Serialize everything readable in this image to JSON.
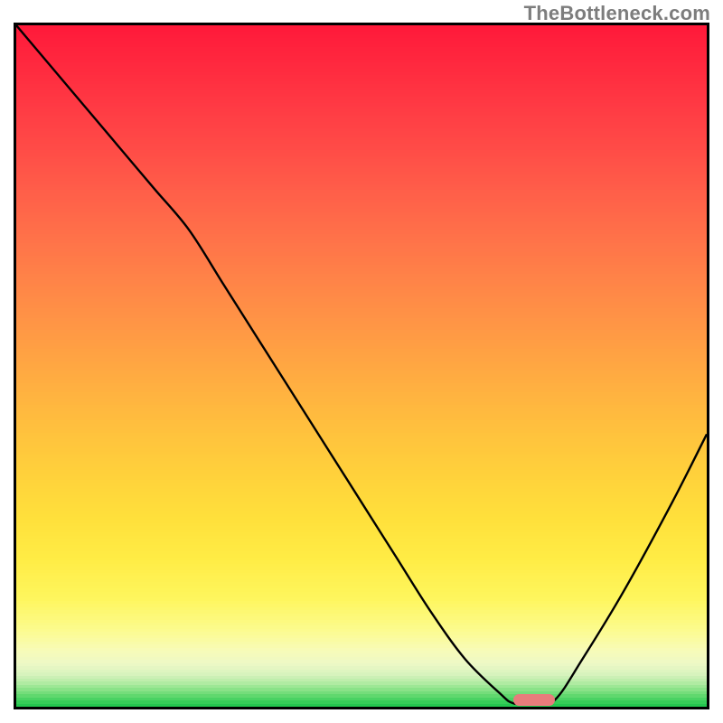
{
  "watermark": "TheBottleneck.com",
  "colors": {
    "frame": "#000000",
    "curve": "#000000",
    "marker": "#e87c7c"
  },
  "chart_data": {
    "type": "line",
    "title": "",
    "xlabel": "",
    "ylabel": "",
    "xlim": [
      0,
      100
    ],
    "ylim": [
      0,
      100
    ],
    "grid": false,
    "legend": false,
    "background_gradient_description": "vertical gradient red → orange → yellow → pale-yellow → green (bottleneck severity scale)",
    "curve": {
      "description": "Bottleneck severity curve; single V-shaped dip reaching 0 near x≈75",
      "x": [
        0,
        5,
        10,
        15,
        20,
        25,
        30,
        35,
        40,
        45,
        50,
        55,
        60,
        65,
        70,
        72,
        75,
        78,
        82,
        88,
        95,
        100
      ],
      "y": [
        100,
        94,
        88,
        82,
        76,
        70,
        62,
        54,
        46,
        38,
        30,
        22,
        14,
        7,
        2,
        0.5,
        0.5,
        1,
        7,
        17,
        30,
        40
      ]
    },
    "optimal_marker": {
      "x_start": 72,
      "x_end": 78,
      "y": 0.2
    },
    "gradient_stops": [
      {
        "pct": 0.0,
        "color": "#ff1a3a"
      },
      {
        "pct": 0.06,
        "color": "#ff2a3f"
      },
      {
        "pct": 0.12,
        "color": "#ff3b44"
      },
      {
        "pct": 0.18,
        "color": "#ff4c47"
      },
      {
        "pct": 0.24,
        "color": "#ff5e49"
      },
      {
        "pct": 0.3,
        "color": "#ff6f49"
      },
      {
        "pct": 0.36,
        "color": "#ff8048"
      },
      {
        "pct": 0.42,
        "color": "#ff9146"
      },
      {
        "pct": 0.48,
        "color": "#ffa243"
      },
      {
        "pct": 0.54,
        "color": "#ffb340"
      },
      {
        "pct": 0.6,
        "color": "#ffc33d"
      },
      {
        "pct": 0.66,
        "color": "#ffd23b"
      },
      {
        "pct": 0.72,
        "color": "#ffe03b"
      },
      {
        "pct": 0.78,
        "color": "#ffec45"
      },
      {
        "pct": 0.84,
        "color": "#fef65e"
      },
      {
        "pct": 0.885,
        "color": "#fcfb8e"
      },
      {
        "pct": 0.915,
        "color": "#f8fbb8"
      },
      {
        "pct": 0.935,
        "color": "#edf8c6"
      },
      {
        "pct": 0.95,
        "color": "#d7f3bd"
      },
      {
        "pct": 0.962,
        "color": "#b6eca6"
      },
      {
        "pct": 0.972,
        "color": "#8de38a"
      },
      {
        "pct": 0.981,
        "color": "#63d970"
      },
      {
        "pct": 0.989,
        "color": "#3ecf5c"
      },
      {
        "pct": 0.995,
        "color": "#25c750"
      },
      {
        "pct": 1.0,
        "color": "#16c148"
      }
    ]
  }
}
